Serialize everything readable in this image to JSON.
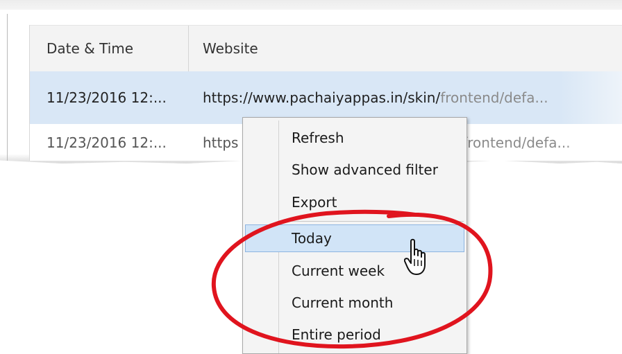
{
  "table": {
    "headers": {
      "date": "Date & Time",
      "website": "Website"
    },
    "rows": [
      {
        "date": "11/23/2016 12:...",
        "url_prefix": "https://www.pachaiyappas.in/skin/",
        "url_rest": "frontend/defa..."
      },
      {
        "date": "11/23/2016 12:...",
        "url_prefix": "https",
        "url_rest": "/frontend/defa..."
      }
    ]
  },
  "context_menu": {
    "items": [
      {
        "label": "Refresh"
      },
      {
        "label": "Show advanced filter"
      },
      {
        "label": "Export"
      },
      {
        "label": "Today",
        "state": "hover"
      },
      {
        "label": "Current week"
      },
      {
        "label": "Current month"
      },
      {
        "label": "Entire period"
      }
    ]
  },
  "colors": {
    "selected_row": "#d9e7f6",
    "menu_highlight": "#d1e4f7",
    "annotation": "#e0141e"
  },
  "icons": {
    "cursor": "hand-pointer-icon"
  }
}
